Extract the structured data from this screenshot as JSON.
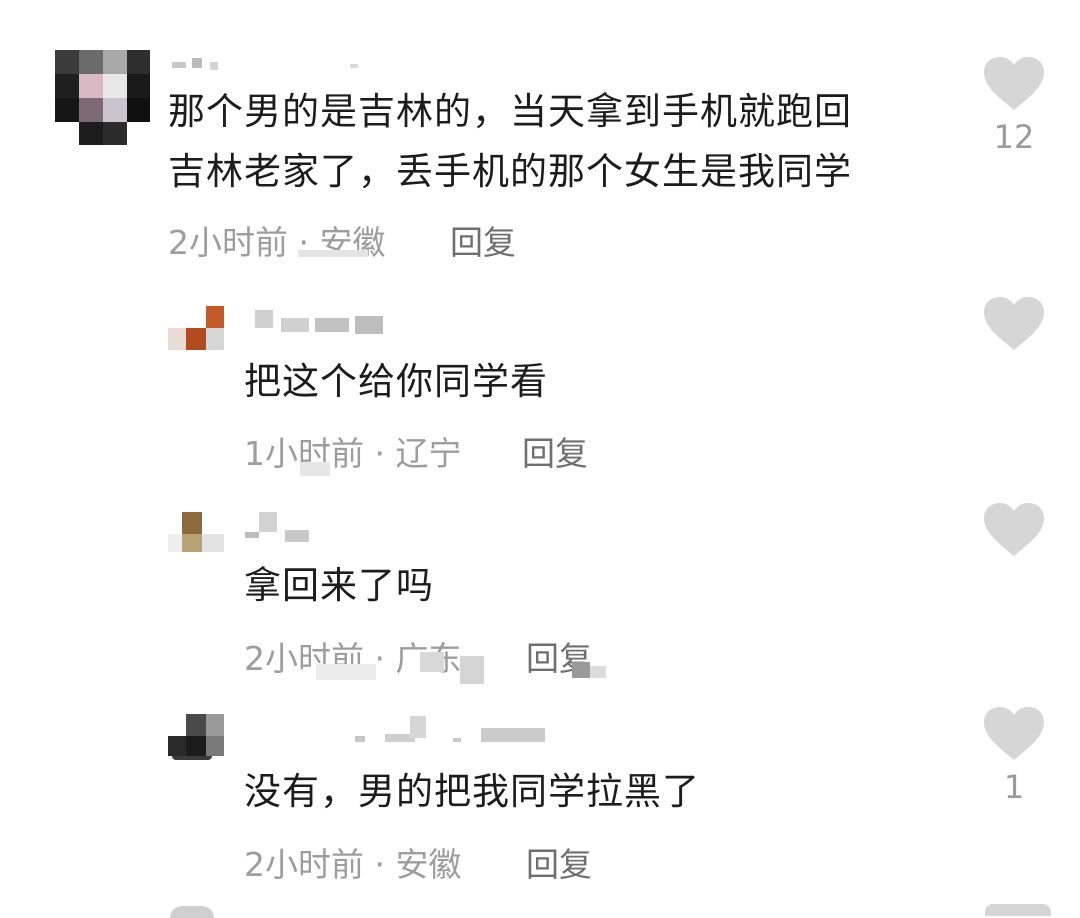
{
  "comments": [
    {
      "username": "",
      "text_lines": [
        "那个男的是吉林的，当天拿到手机就跑回",
        "吉林老家了，丢手机的那个女生是我同学"
      ],
      "time": "2小时前",
      "location": "安徽",
      "reply_label": "回复",
      "like_count": "12"
    },
    {
      "username": "",
      "text_lines": [
        "把这个给你同学看"
      ],
      "time": "1小时前",
      "location": "辽宁",
      "reply_label": "回复",
      "like_count": ""
    },
    {
      "username": "",
      "text_lines": [
        "拿回来了吗"
      ],
      "time": "2小时前",
      "location": "广东",
      "reply_label": "回复",
      "like_count": ""
    },
    {
      "username": "",
      "text_lines": [
        "没有，男的把我同学拉黑了"
      ],
      "time": "2小时前",
      "location": "安徽",
      "reply_label": "回复",
      "like_count": "1"
    }
  ],
  "meta_separator": " · ",
  "icons": {
    "like": "heart-icon"
  },
  "colors": {
    "text": "#1c1c1c",
    "meta": "#9d9d9d",
    "reply": "#6f6f6f",
    "heart": "#d6d6d6"
  }
}
